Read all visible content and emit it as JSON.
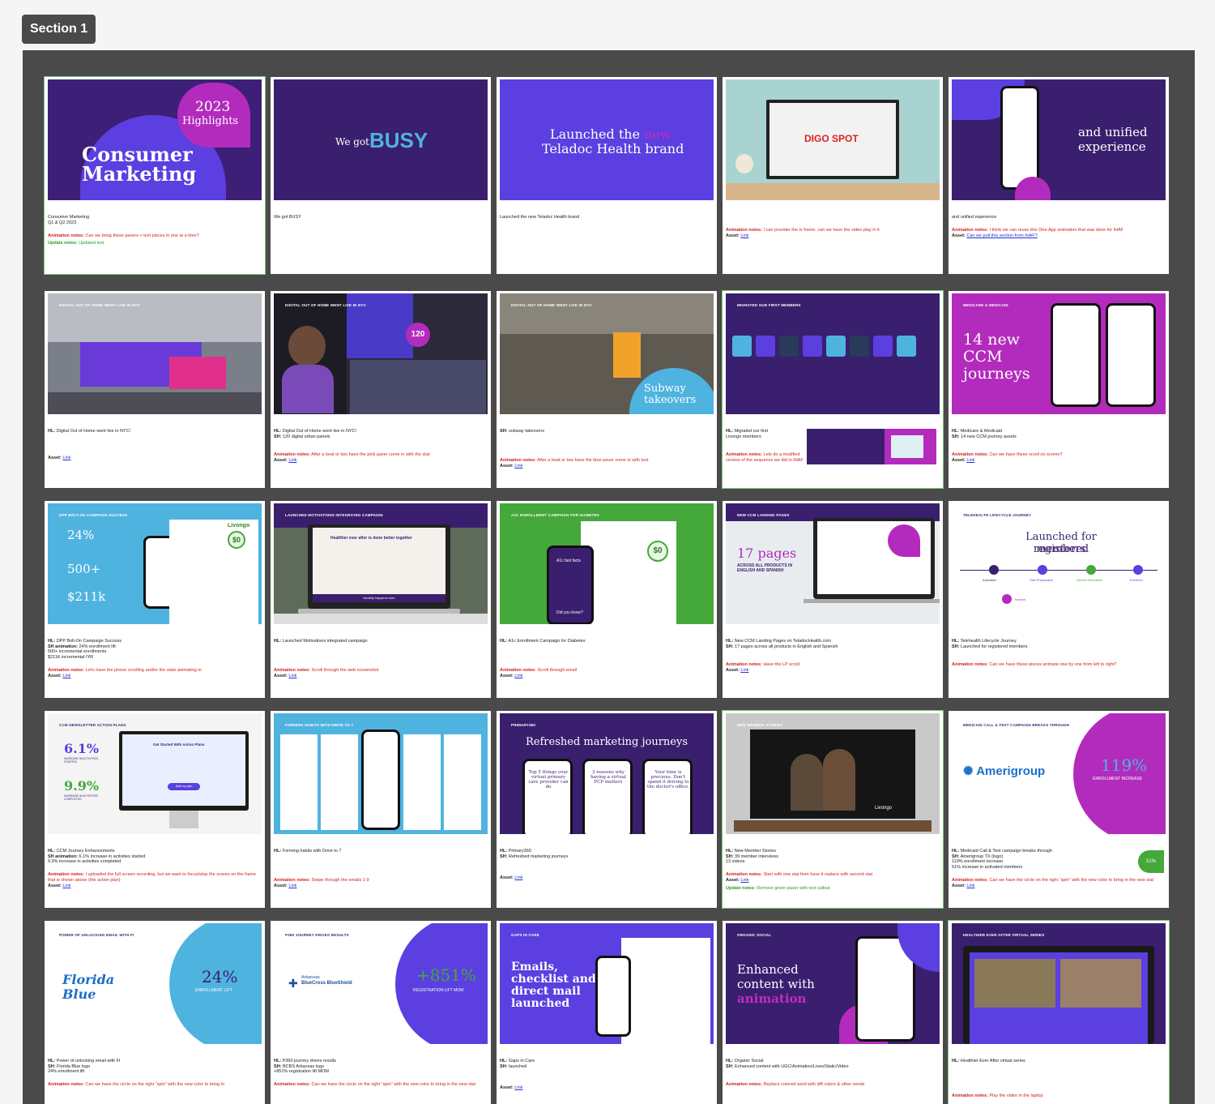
{
  "section": {
    "label": "Section 1"
  },
  "colors": {
    "purple_dark": "#3a1f6e",
    "purple": "#5b3fe0",
    "magenta": "#b32bbd",
    "green": "#44a83a",
    "blue": "#4fb3e0"
  },
  "slides": [
    {
      "thumb_texts": {
        "t1": "2023",
        "t2": "Highlights",
        "t3": "Consumer",
        "t4": "Marketing"
      },
      "hl": "Consumer Marketing\nQ1 & Q2 2023",
      "anim_label": "Animation notes:",
      "anim": "Can we bring these pavers + text pieces in one at a time?",
      "upd_label": "Update notes:",
      "upd": "Updated text"
    },
    {
      "thumb_texts": {
        "t1": "We got",
        "t2": "BUSY"
      },
      "hl": "We got BUSY"
    },
    {
      "thumb_texts": {
        "t1": "Launched the",
        "t2": "new",
        "t3": "Teladoc Health brand"
      },
      "hl": "Launched the new Teladoc Health brand"
    },
    {
      "thumb_texts": {
        "t1": "DIGO SPOT"
      },
      "anim_label": "Animation notes:",
      "anim": "I can provider the tv frame, can we have the video play in it",
      "asset_label": "Asset:",
      "asset": "Link"
    },
    {
      "thumb_texts": {
        "t1": "and unified",
        "t2": "experience"
      },
      "hl": "and unified experience",
      "anim_label": "Animation notes:",
      "anim": "I think we can reuse this One-App animation that was done for IHAF",
      "asset_label": "Asset:",
      "asset": "Can we pull this section from IHAF?"
    },
    {
      "thumb_texts": {
        "t1": "DIGITAL OUT OF HOME WENT LIVE IN NYC"
      },
      "hl_label": "HL:",
      "hl": "Digital Out of Home went live in NYC!",
      "asset_label": "Asset:",
      "asset": "Link"
    },
    {
      "thumb_texts": {
        "t1": "DIGITAL OUT OF HOME WENT LIVE IN NYC",
        "t2": "120"
      },
      "hl_label": "HL:",
      "hl": "Digital Out of Home went live in NYC!",
      "sh_label": "SH:",
      "sh": "120 digital urban panels",
      "anim_label": "Animation notes:",
      "anim": "After a beat or two have the pink paver come in with the stat",
      "asset_label": "Asset:",
      "asset": "Link"
    },
    {
      "thumb_texts": {
        "t1": "DIGITAL OUT OF HOME WENT LIVE IN NYC",
        "t2": "Subway",
        "t3": "takeovers"
      },
      "sh_label": "SH:",
      "sh": "subway takeovers",
      "anim_label": "Animation notes:",
      "anim": "After a beat or two have the blue paver come in with text",
      "asset_label": "Asset:",
      "asset": "Link"
    },
    {
      "thumb_texts": {
        "t1": "MIGRATED OUR FIRST MEMBERS"
      },
      "hl_label": "HL:",
      "hl": "Migrated our first\nLivongo members",
      "anim_label": "Animation notes:",
      "anim": "Lets do a modified version of the sequence we did in IHAF"
    },
    {
      "thumb_texts": {
        "t1": "MEDICARE & MEDICAID",
        "t2": "14 new",
        "t3": "CCM",
        "t4": "journeys"
      },
      "hl_label": "HL:",
      "hl": "Medicare & Medicaid",
      "sh_label": "SH:",
      "sh": "14 new CCM journey assets",
      "anim_label": "Animation notes:",
      "anim": "Can we have these scroll on screen?",
      "asset_label": "Asset:",
      "asset": "Link"
    },
    {
      "thumb_texts": {
        "t1": "DPP BOLT-ON CAMPAIGN SUCCESS",
        "t2": "24%",
        "t3": "500+",
        "t4": "$211k",
        "t5": "Livongo",
        "t6": "$0"
      },
      "hl_label": "HL:",
      "hl": "DPP Bolt-On Campaign Success",
      "sh_label": "SH animation:",
      "sh": "24% enrollment lift\n500+ incremental enrollments\n$211K incremental IYR",
      "anim_label": "Animation notes:",
      "anim": "Let's have the phone scrolling and/or the stats animating in",
      "asset_label": "Asset:",
      "asset": "Link"
    },
    {
      "thumb_texts": {
        "t1": "LAUNCHED MOTIVATIONS INTEGRATED CAMPAIGN",
        "t2": "Healthier ever after is done better together",
        "t3": "Healthy happens here"
      },
      "hl_label": "HL:",
      "hl": "Launched Motivations integrated campaign",
      "anim_label": "Animation notes:",
      "anim": "Scroll through the web screenshot",
      "asset_label": "Asset:",
      "asset": "Link"
    },
    {
      "thumb_texts": {
        "t1": "A1C ENROLLMENT CAMPAIGN FOR DIABETES",
        "t2": "A1c fast facts",
        "t3": "Did you know?",
        "t4": "$0"
      },
      "hl_label": "HL:",
      "hl": "A1c Enrollment Campaign for Diabetes",
      "anim_label": "Animation notes:",
      "anim": "Scroll through email",
      "asset_label": "Asset:",
      "asset": "Link"
    },
    {
      "thumb_texts": {
        "t1": "NEW CCM LANDING PAGES",
        "t2": "17 pages",
        "t3": "ACROSS ALL PRODUCTS IN ENGLISH AND SPANISH"
      },
      "hl_label": "HL:",
      "hl": "New CCM Landing Pages on TeladocHealth.com",
      "sh_label": "SH:",
      "sh": "17 pages across all products in English and Spanish",
      "anim_label": "Animation notes:",
      "anim": "Have the LP scroll",
      "asset_label": "Asset:",
      "asset": "Link"
    },
    {
      "thumb_texts": {
        "t1": "TELEHEALTH LIFECYCLE JOURNEY",
        "t2": "Launched for registered",
        "t3": "members",
        "s1": "Activation",
        "s2": "Visit Preparation",
        "s3": "Service Education",
        "s4": "Eve/Intro",
        "s5": "Nurture"
      },
      "hl_label": "HL:",
      "hl": "Telehealth Lifecycle Journey",
      "sh_label": "SH:",
      "sh": "Launched for registered members",
      "anim_label": "Animation notes:",
      "anim": "Can we have these pieces animate one by one from left to right?"
    },
    {
      "thumb_texts": {
        "t1": "CCM NEWSLETTER ACTION PLANS",
        "t2": "6.1%",
        "t3": "INCREASE IN ACTIVITIES STARTED",
        "t4": "9.9%",
        "t5": "INCREASE IN ACTIVITIES COMPLETED",
        "t6": "Get Started With Action Plans",
        "t7": "Start my plan"
      },
      "hl_label": "HL:",
      "hl": "CCM Journey Enhancements",
      "sh_label": "SH animation:",
      "sh": "6.1% increase in activities started\n9.9% increase in activities completed",
      "anim_label": "Animation notes:",
      "anim": "I uploaded the full screen recording, but we want to focus/stop the screen on the frame that is shown above (the action plan)",
      "asset_label": "Asset:",
      "asset": "Link"
    },
    {
      "thumb_texts": {
        "t1": "FORMING HABITS WITH DRIVE TO 7"
      },
      "hl_label": "HL:",
      "hl": "Forming habits with Drive to 7",
      "anim_label": "Animation notes:",
      "anim": "Swipe through the emails 1-9",
      "asset_label": "Asset:",
      "asset": "Link"
    },
    {
      "thumb_texts": {
        "t1": "PRIMARY360",
        "t2": "Refreshed marketing journeys",
        "t3": "Top 5 things your virtual primary care provider can do",
        "t4": "3 reasons why having a virtual PCP matters",
        "t5": "Your time is precious. Don't spend it driving to the doctor's office."
      },
      "hl_label": "HL:",
      "hl": "Primary360",
      "sh_label": "SH:",
      "sh": "Refreshed marketing journeys",
      "asset_label": "Asset:",
      "asset": "Link"
    },
    {
      "thumb_texts": {
        "t1": "NEW MEMBER STORIES",
        "t2": "Livongo"
      },
      "hl_label": "HL:",
      "hl": "New Member Stories",
      "sh_label": "SH:",
      "sh": "39 member interviews\n13 videos",
      "anim_label": "Animation notes:",
      "anim": "Start with one stat then have it replace with second stat",
      "asset_label": "Asset:",
      "asset": "Link",
      "upd_label": "Update notes:",
      "upd": "Remove green paver with text callout"
    },
    {
      "thumb_texts": {
        "t1": "MEDICAID CALL & TEXT CAMPAIGN BREAKS THROUGH",
        "t2": "Amerigroup",
        "t3": "119%",
        "t4": "ENROLLMENT INCREASE",
        "t5": "51%"
      },
      "hl_label": "HL:",
      "hl": "Medicaid Call & Text campaign breaks through",
      "sh_label": "SH:",
      "sh": "Amerigroup TX (logo)\n119% enrollment increase\n51% increase in activated members",
      "anim_label": "Animation notes:",
      "anim": "Can we have the circle on the right \"spin\" with the new color to bring in the new stat",
      "asset_label": "Asset:",
      "asset": "Link"
    },
    {
      "thumb_texts": {
        "t1": "POWER OF UNLOCKING EMAIL WITH FI",
        "t2": "Florida",
        "t3": "Blue",
        "t4": "24%",
        "t5": "ENROLLMENT LIFT"
      },
      "hl_label": "HL:",
      "hl": "Power of unlocking email with FI",
      "sh_label": "SH:",
      "sh": "Florida Blue logo\n24% enrollment lift",
      "anim_label": "Animation notes:",
      "anim": "Can we have the circle on the right \"spin\" with the new color to bring in"
    },
    {
      "thumb_texts": {
        "t1": "P360 JOURNEY DRIVES RESULTS",
        "t2": "Arkansas",
        "t3": "BlueCross BlueShield",
        "t4": "+851%",
        "t5": "REGISTRATION LIFT MOM"
      },
      "hl_label": "HL:",
      "hl": "P360 journey drives results",
      "sh_label": "SH:",
      "sh": "BCBS Arkansas logo\n+851% registration lift MOM",
      "anim_label": "Animation notes:",
      "anim": "Can we have the circle on the right \"spin\" with the new color to bring in the new stat"
    },
    {
      "thumb_texts": {
        "t1": "GAPS IN CARE",
        "t2": "Emails,",
        "t3": "checklist and",
        "t4": "direct mail",
        "t5": "launched"
      },
      "hl_label": "HL:",
      "hl": "Gaps in Care",
      "sh_label": "SH:",
      "sh": "launched",
      "asset_label": "Asset:",
      "asset": "Link"
    },
    {
      "thumb_texts": {
        "t1": "ORGANIC SOCIAL",
        "t2": "Enhanced",
        "t3": "content with",
        "t4": "animation"
      },
      "hl_label": "HL:",
      "hl": "Organic Social",
      "sh_label": "SH:",
      "sh": "Enhanced content with UGC/Animation/Lives/Static/Video",
      "anim_label": "Animation notes:",
      "anim": "Replace colored word with diff colors & other words"
    },
    {
      "thumb_texts": {
        "t1": "HEALTHIER EVER AFTER VIRTUAL SERIES"
      },
      "hl_label": "HL:",
      "hl": "Healthier Ever After virtual series",
      "anim_label": "Animation notes:",
      "anim": "Play the video in the laptop"
    }
  ]
}
